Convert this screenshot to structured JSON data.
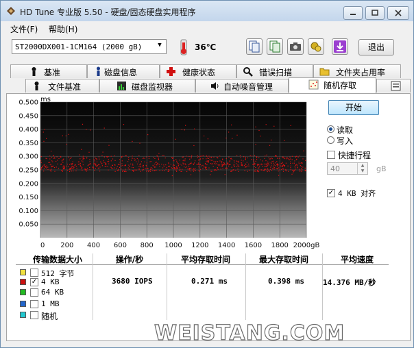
{
  "window": {
    "title": "HD Tune 专业版 5.50 - 硬盘/固态硬盘实用程序"
  },
  "menu": {
    "file": "文件(F)",
    "help": "帮助(H)"
  },
  "toolbar": {
    "drive": "ST2000DX001-1CM164 (2000 gB)",
    "temperature": "36℃",
    "exit_label": "退出",
    "icons": [
      "thermometer-icon",
      "copy-icon",
      "copy-text-icon",
      "camera-icon",
      "options-icon",
      "download-icon"
    ]
  },
  "tabs_row1": [
    {
      "label": "基准",
      "icon": "benchmark-icon"
    },
    {
      "label": "磁盘信息",
      "icon": "info-icon"
    },
    {
      "label": "健康状态",
      "icon": "health-icon"
    },
    {
      "label": "错误扫描",
      "icon": "scan-icon"
    },
    {
      "label": "文件夹占用率",
      "icon": "folder-icon"
    }
  ],
  "tabs_row2": [
    {
      "label": "文件基准",
      "icon": "file-benchmark-icon"
    },
    {
      "label": "磁盘监视器",
      "icon": "monitor-icon"
    },
    {
      "label": "自动噪音管理",
      "icon": "speaker-icon"
    },
    {
      "label": "随机存取",
      "icon": "random-access-icon",
      "active": true
    }
  ],
  "side": {
    "start_label": "开始",
    "read_label": "读取",
    "write_label": "写入",
    "mode": "read",
    "short_stroke_label": "快捷行程",
    "short_stroke_checked": false,
    "short_stroke_value": "40",
    "short_stroke_unit": "gB",
    "align_label": "4 KB 对齐",
    "align_checked": true
  },
  "chart_data": {
    "type": "scatter",
    "ylabel": "ms",
    "y_ticks": [
      "0.500",
      "0.450",
      "0.400",
      "0.350",
      "0.300",
      "0.250",
      "0.200",
      "0.150",
      "0.100",
      "0.050"
    ],
    "x_ticks": [
      "0",
      "200",
      "400",
      "600",
      "800",
      "1000",
      "1200",
      "1400",
      "1600",
      "1800",
      "2000gB"
    ],
    "xlim": [
      0,
      2000
    ],
    "ylim": [
      0,
      0.5
    ],
    "grid": true,
    "series": [
      {
        "color": "#dd1111",
        "band": [
          0.24,
          0.31
        ],
        "x_range": [
          0,
          2000
        ],
        "count": 900
      }
    ]
  },
  "table": {
    "headers": [
      "传输数据大小",
      "操作/秒",
      "平均存取时间",
      "最大存取时间",
      "平均速度"
    ],
    "rows": [
      {
        "label": "512 字节",
        "color": "#f0e040",
        "checked": false
      },
      {
        "label": "4 KB",
        "color": "#cc1111",
        "checked": true,
        "ops": "3680 IOPS",
        "avg": "0.271 ms",
        "max": "0.398 ms",
        "speed": "14.376 MB/秒"
      },
      {
        "label": "64 KB",
        "color": "#22bb22",
        "checked": false
      },
      {
        "label": "1 MB",
        "color": "#2266cc",
        "checked": false
      },
      {
        "label": "随机",
        "color": "#22c8d0",
        "checked": false
      }
    ]
  },
  "watermark": "WEISTANG.COM"
}
